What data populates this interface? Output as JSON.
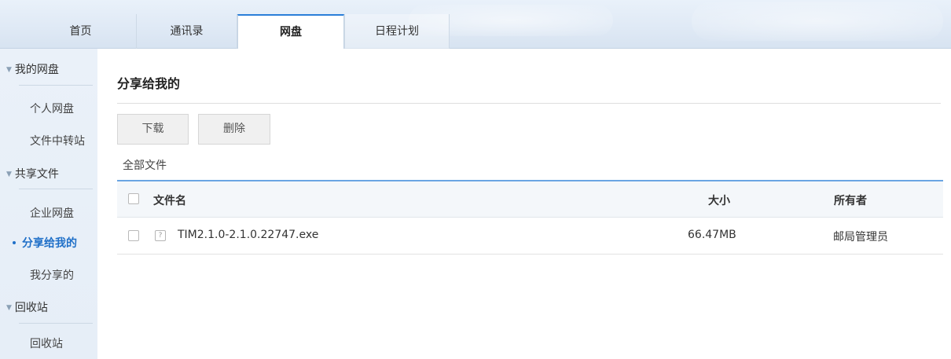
{
  "tabs": [
    {
      "label": "首页"
    },
    {
      "label": "通讯录"
    },
    {
      "label": "网盘"
    },
    {
      "label": "日程计划"
    }
  ],
  "active_tab": "网盘",
  "sidebar": {
    "groups": [
      {
        "label": "我的网盘",
        "items": [
          {
            "label": "个人网盘"
          },
          {
            "label": "文件中转站"
          }
        ]
      },
      {
        "label": "共享文件",
        "items": [
          {
            "label": "企业网盘"
          },
          {
            "label": "分享给我的"
          },
          {
            "label": "我分享的"
          }
        ]
      },
      {
        "label": "回收站",
        "items": [
          {
            "label": "回收站"
          }
        ]
      }
    ],
    "active_item": "分享给我的"
  },
  "main": {
    "title": "分享给我的",
    "toolbar": {
      "download_label": "下载",
      "delete_label": "删除"
    },
    "breadcrumb": "全部文件",
    "table": {
      "columns": {
        "name": "文件名",
        "size": "大小",
        "owner": "所有者"
      },
      "rows": [
        {
          "name": "TIM2.1.0-2.1.0.22747.exe",
          "size": "66.47MB",
          "owner": "邮局管理员",
          "icon": "unknown-file-icon"
        }
      ]
    }
  },
  "colors": {
    "accent": "#2a7ed8",
    "active_link": "#1f6fc8",
    "header_line": "#6aa5e3"
  }
}
